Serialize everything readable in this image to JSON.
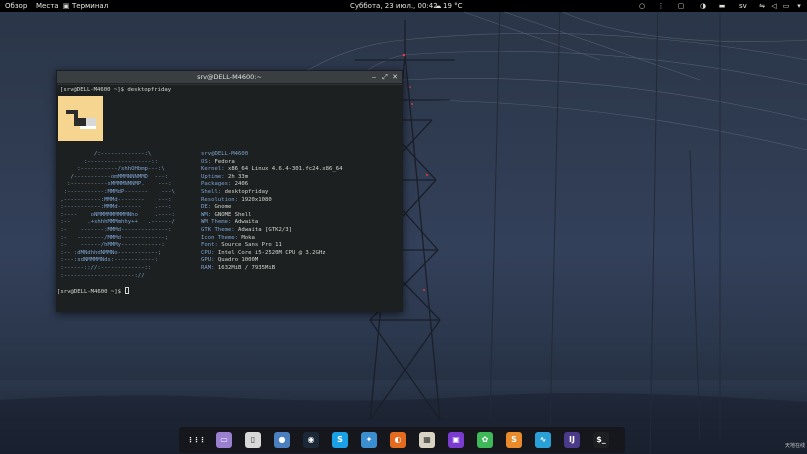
{
  "topbar": {
    "activities": "Обзор",
    "places": "Места",
    "app_menu": "Терминал",
    "clock": "Суббота, 23 июл., 00:42",
    "weather": "19 °C",
    "user": "sv"
  },
  "terminal": {
    "title": "srv@DELL-M4600:~",
    "prompt_line": "[srv@DELL-M4600 ~]$ desktopfriday",
    "ascii_logo": [
      "           /:-------------:\\",
      "        :-------------------::",
      "      :-----------/shhOHbmp---:\\",
      "    /-----------omMMMNNNMMD  ---:",
      "   :-----------sMMMMNMNMP.    ---:",
      "  :-----------:MMMdP-------    ---\\",
      " ,-----------:MMMd--------    ---:",
      " :-----------:MMMd-------    .---:",
      " :----    oNMMMMMMMMMNho     .----:",
      " :--     .+shhhMMMmhhy++   .------/",
      " :-    -------:MMMd--------------:",
      " :-   --------/MMMd-------------;",
      " :-    ------/hMMMy------------:",
      " :-- :dMNdhhdNMMNo------------;",
      " :---:sdNMMMMNds:------------:",
      " :------:://:-------------::",
      " :---------------------://"
    ],
    "info": [
      {
        "key": "",
        "value": "srv@DELL-M4600"
      },
      {
        "key": "OS:",
        "value": " Fedora"
      },
      {
        "key": "Kernel:",
        "value": " x86_64 Linux 4.6.4-301.fc24.x86_64"
      },
      {
        "key": "Uptime:",
        "value": " 2h 33m"
      },
      {
        "key": "Packages:",
        "value": " 2406"
      },
      {
        "key": "Shell:",
        "value": " desktopfriday"
      },
      {
        "key": "Resolution:",
        "value": " 1920x1080"
      },
      {
        "key": "DE:",
        "value": " Gnome"
      },
      {
        "key": "WM:",
        "value": " GNOME Shell"
      },
      {
        "key": "WM Theme:",
        "value": " Adwaita"
      },
      {
        "key": "GTK Theme:",
        "value": " Adwaita [GTK2/3]"
      },
      {
        "key": "Icon Theme:",
        "value": " Moka"
      },
      {
        "key": "Font:",
        "value": " Source Sans Pro 11"
      },
      {
        "key": "CPU:",
        "value": " Intel Core i5-2520M CPU @ 3.2GHz"
      },
      {
        "key": "GPU:",
        "value": " Quadro 1000M"
      },
      {
        "key": "RAM:",
        "value": " 1632MiB / 7935MiB"
      }
    ],
    "prompt_empty": "[srv@DELL-M4600 ~]$ "
  },
  "dock": {
    "items": [
      {
        "name": "app-grid-icon",
        "glyph": "⋮⋮⋮",
        "color": "transparent"
      },
      {
        "name": "files-icon",
        "glyph": "▭",
        "color": "#9b7fd0"
      },
      {
        "name": "document-icon",
        "glyph": "▯",
        "color": "#d8d8d8"
      },
      {
        "name": "pidgin-icon",
        "glyph": "●",
        "color": "#4a7fc0"
      },
      {
        "name": "steam-icon",
        "glyph": "◉",
        "color": "#1b2838"
      },
      {
        "name": "skype-icon",
        "glyph": "S",
        "color": "#1aa0e6"
      },
      {
        "name": "safari-compass-icon",
        "glyph": "✦",
        "color": "#3b8fd0"
      },
      {
        "name": "firefox-icon",
        "glyph": "◐",
        "color": "#e56b1f"
      },
      {
        "name": "pinta-icon",
        "glyph": "▦",
        "color": "#d9d3c3"
      },
      {
        "name": "image-viewer-icon",
        "glyph": "▣",
        "color": "#7a3bd0"
      },
      {
        "name": "gimp-icon",
        "glyph": "✿",
        "color": "#3fb85a"
      },
      {
        "name": "sublime-icon",
        "glyph": "S",
        "color": "#e88b2a"
      },
      {
        "name": "monitor-icon",
        "glyph": "∿",
        "color": "#2aa0d8"
      },
      {
        "name": "intellij-icon",
        "glyph": "IJ",
        "color": "#4a3a8a"
      },
      {
        "name": "terminal-icon",
        "glyph": "$_",
        "color": "#1d1f21"
      }
    ]
  },
  "corner_label": "天地在线"
}
